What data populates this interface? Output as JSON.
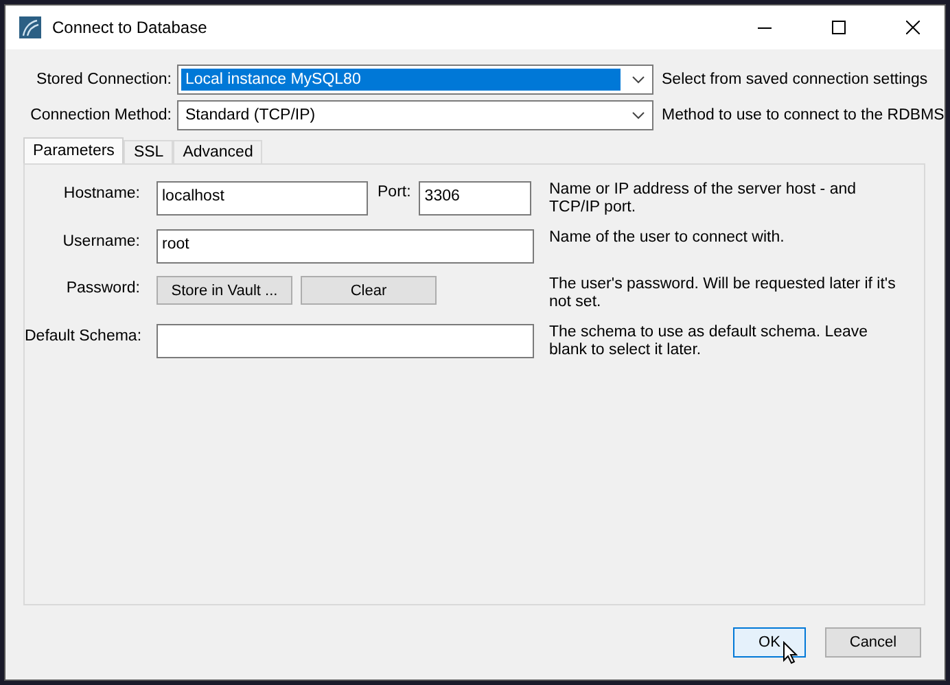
{
  "window": {
    "title": "Connect to Database"
  },
  "connection_rows": [
    {
      "label": "Stored Connection:",
      "value": "Local instance MySQL80",
      "highlighted": true,
      "hint": "Select from saved connection settings"
    },
    {
      "label": "Connection Method:",
      "value": "Standard (TCP/IP)",
      "highlighted": false,
      "hint": "Method to use to connect to the RDBMS"
    }
  ],
  "tabs": [
    {
      "label": "Parameters",
      "selected": true
    },
    {
      "label": "SSL",
      "selected": false
    },
    {
      "label": "Advanced",
      "selected": false
    }
  ],
  "parameters": [
    {
      "kind": "host",
      "label": "Hostname:",
      "value": "localhost",
      "port_label": "Port:",
      "port_value": "3306",
      "hint": "Name or IP address of the server host - and TCP/IP port."
    },
    {
      "kind": "text",
      "label": "Username:",
      "value": "root",
      "hint": "Name of the user to connect with."
    },
    {
      "kind": "buttons",
      "label": "Password:",
      "buttons": [
        "Store in Vault ...",
        "Clear"
      ],
      "hint": "The user's password. Will be requested later if it's not set."
    },
    {
      "kind": "text",
      "label": "Default Schema:",
      "hint": "The schema to use as default schema. Leave blank to select it later."
    }
  ],
  "footer_buttons": [
    {
      "label": "OK",
      "default": true
    },
    {
      "label": "Cancel",
      "default": false
    }
  ]
}
